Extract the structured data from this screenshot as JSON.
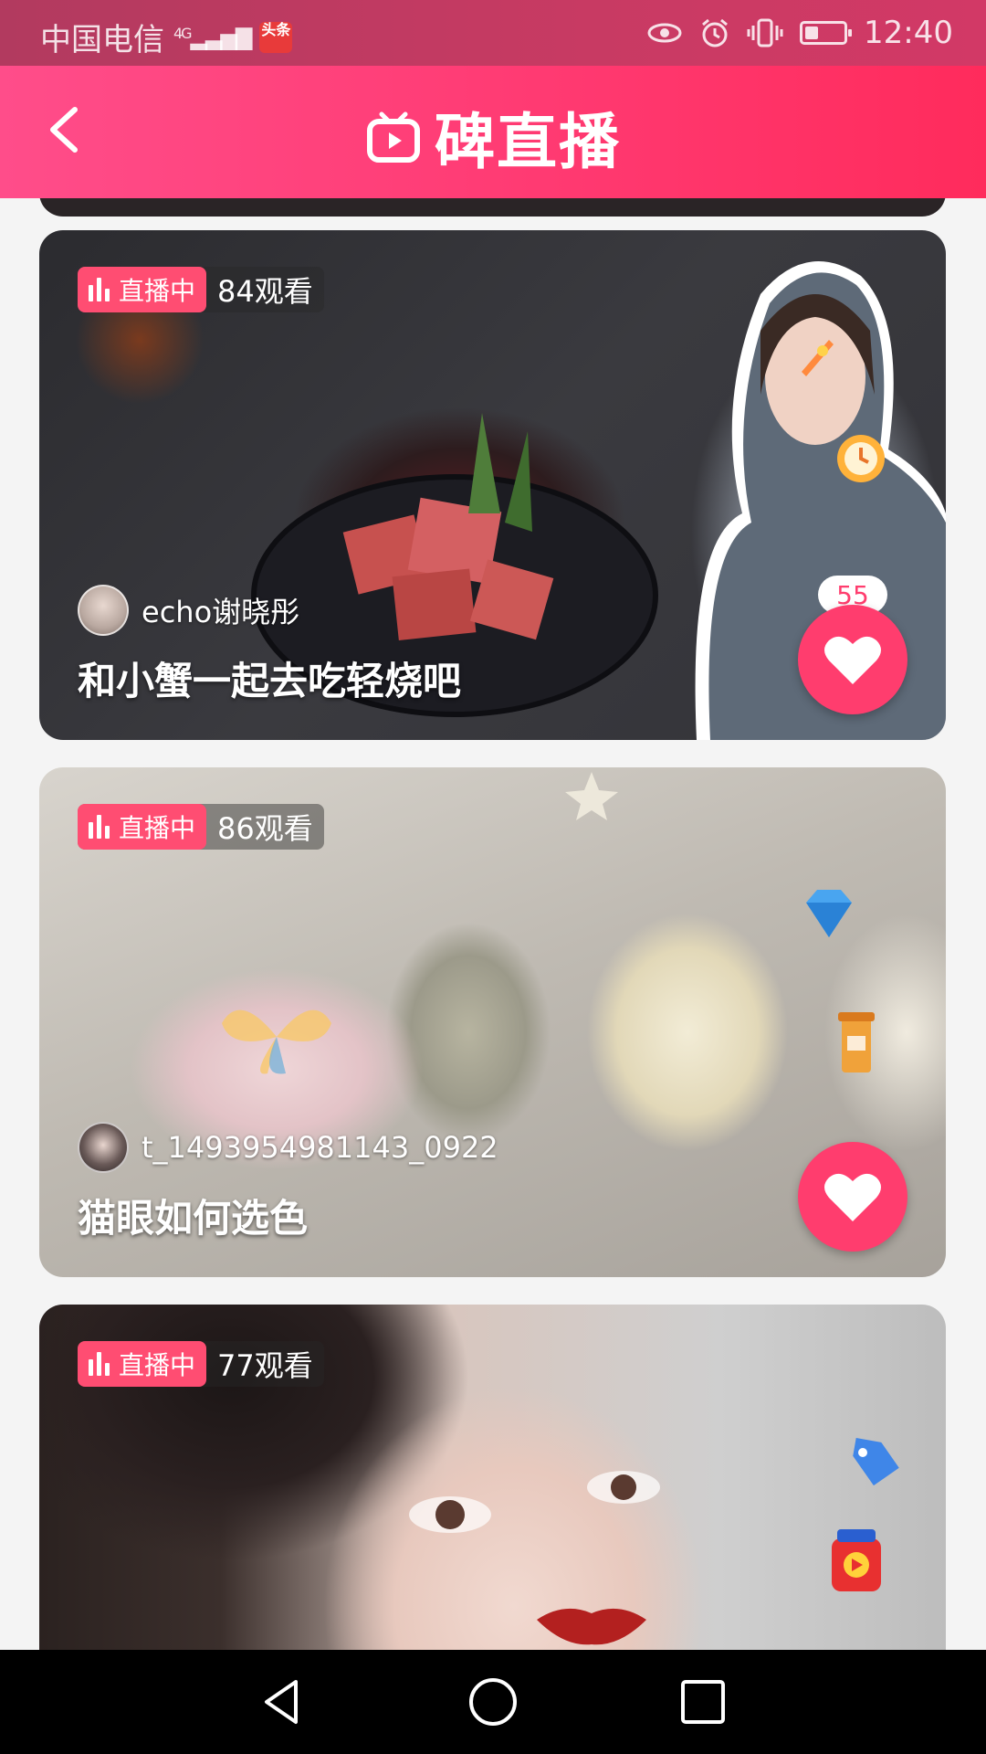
{
  "status_bar": {
    "carrier": "中国电信",
    "network": "4G",
    "app_badge": "头条",
    "time": "12:40"
  },
  "header": {
    "title": "碑直播"
  },
  "cards": [
    {
      "live_label": "直播中",
      "viewers": "84观看",
      "streamer": "echo谢晓彤",
      "title": "和小蟹一起去吃轻烧吧",
      "likes": "55"
    },
    {
      "live_label": "直播中",
      "viewers": "86观看",
      "streamer": "t_1493954981143_0922",
      "title": "猫眼如何选色"
    },
    {
      "live_label": "直播中",
      "viewers": "77观看"
    }
  ],
  "colors": {
    "accent": "#ff3d6e",
    "header_gradient_start": "#ff4d8a",
    "header_gradient_end": "#ff2b5c"
  }
}
